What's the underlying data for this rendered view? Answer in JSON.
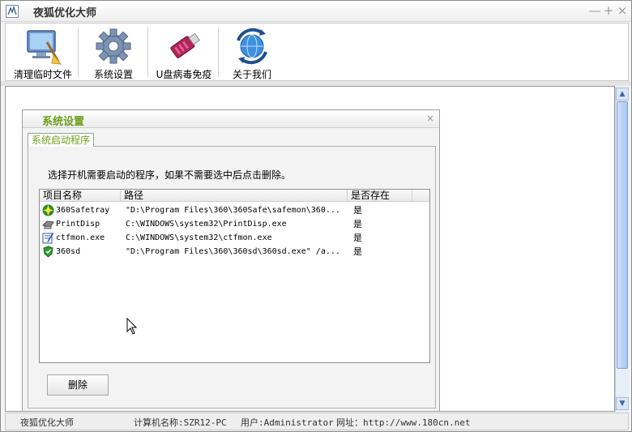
{
  "window": {
    "title": "夜狐优化大师",
    "icon": "app-icon",
    "controls": {
      "minimize": "—",
      "maximize": "+",
      "close": "×"
    }
  },
  "toolbar": {
    "items": [
      {
        "label": "清理临时文件",
        "icon": "monitor-broom-icon"
      },
      {
        "label": "系统设置",
        "icon": "gear-icon"
      },
      {
        "label": "U盘病毒免疫",
        "icon": "usb-drive-icon"
      },
      {
        "label": "关于我们",
        "icon": "globe-refresh-icon"
      }
    ]
  },
  "dialog": {
    "title": "系统设置",
    "close": "×",
    "tab": "系统启动程序",
    "instruction": "选择开机需要启动的程序，如果不需要选中后点击删除。",
    "columns": [
      "项目名称",
      "路径",
      "是否存在"
    ],
    "rows": [
      {
        "name": "360Safetray",
        "path": "\"D:\\Program Files\\360\\360Safe\\safemon\\360...",
        "exists": "是",
        "icon": "360safe-icon"
      },
      {
        "name": "PrintDisp",
        "path": "C:\\WINDOWS\\system32\\PrintDisp.exe",
        "exists": "是",
        "icon": "printer-icon"
      },
      {
        "name": "ctfmon.exe",
        "path": "C:\\WINDOWS\\system32\\ctfmon.exe",
        "exists": "是",
        "icon": "notepad-pen-icon"
      },
      {
        "name": "360sd",
        "path": "\"D:\\Program Files\\360\\360sd\\360sd.exe\" /a...",
        "exists": "是",
        "icon": "shield-icon"
      }
    ],
    "delete_label": "删除"
  },
  "statusbar": {
    "app_name": "夜狐优化大师",
    "computer": "计算机名称:SZR12-PC",
    "user": "用户:Administrator",
    "website": "网址：http://www.180cn.net"
  }
}
